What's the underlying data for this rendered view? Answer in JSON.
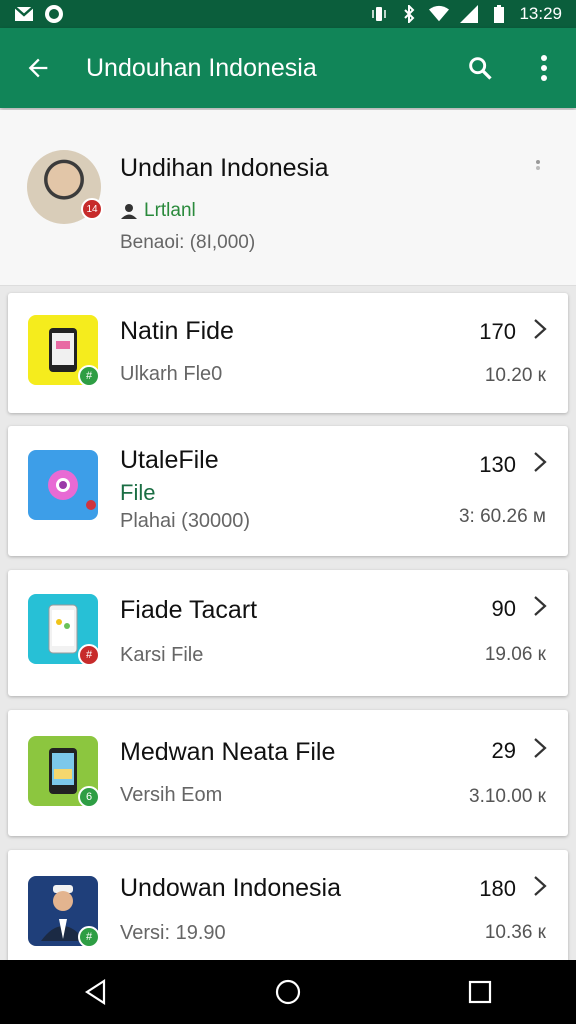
{
  "status_bar": {
    "time": "13:29",
    "icons": [
      "gmail-icon",
      "whatsapp-icon",
      "vibrate-icon",
      "bluetooth-icon",
      "wifi-icon",
      "signal-icon",
      "battery-icon"
    ]
  },
  "app_bar": {
    "title": "Undouhan Indonesia",
    "back_icon": "arrow-left-icon",
    "search_icon": "search-icon",
    "menu_icon": "more-vert-icon"
  },
  "profile": {
    "name": "Undihan Indonesia",
    "status": "Lrtlanl",
    "meta": "Benaoi: (8I,000)",
    "badge": "14"
  },
  "items": [
    {
      "title": "Natin Fide",
      "subtitle": "Ulkarh Fle0",
      "count": "170",
      "size": "10.20 к",
      "thumb_color": "#f5ec1d",
      "badge_color": "#2e9e44",
      "badge": "#"
    },
    {
      "title": "UtaleFile",
      "title2": "File",
      "subtitle": "Plahai (30000)",
      "count": "130",
      "size": "3: 60.26 м",
      "thumb_color": "#3d9ee8",
      "badge_color": "#d0343e",
      "badge": ""
    },
    {
      "title": "Fiade Tacart",
      "subtitle": "Karsi File",
      "count": "90",
      "size": "19.06 к",
      "thumb_color": "#27c0d6",
      "badge_color": "#c72b2b",
      "badge": "#"
    },
    {
      "title": "Medwan Neata File",
      "subtitle": "Versih Eom",
      "count": "29",
      "size": "3.10.00 к",
      "thumb_color": "#8cc63f",
      "badge_color": "#2e9e44",
      "badge": "6"
    },
    {
      "title": "Undowan Indonesia",
      "subtitle": "Versi: 19.90",
      "count": "180",
      "size": "10.36 к",
      "thumb_color": "#1f3f7a",
      "badge_color": "#2e9e44",
      "badge": "#"
    }
  ],
  "nav": {
    "back": "nav-back-icon",
    "home": "nav-home-icon",
    "recents": "nav-recents-icon"
  }
}
